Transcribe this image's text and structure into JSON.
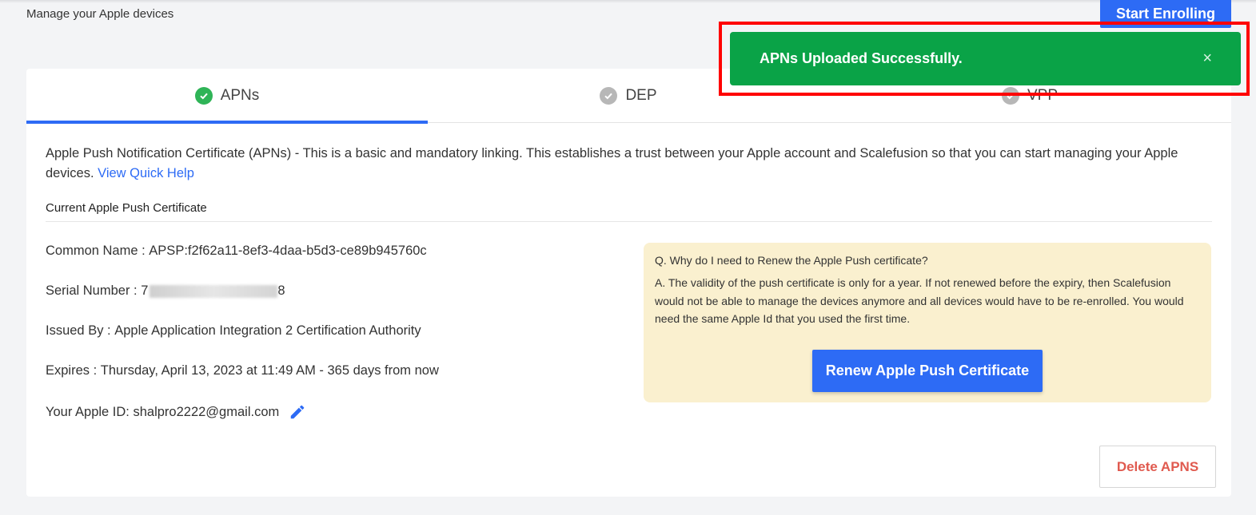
{
  "header": {
    "subtitle": "Manage your Apple devices",
    "start_enrolling_label": "Start Enrolling"
  },
  "tabs": [
    {
      "label": "APNs",
      "status": "complete",
      "active": true
    },
    {
      "label": "DEP",
      "status": "incomplete",
      "active": false
    },
    {
      "label": "VPP",
      "status": "incomplete",
      "active": false
    }
  ],
  "apns": {
    "description": "Apple Push Notification Certificate (APNs) - This is a basic and mandatory linking. This establishes a trust between your Apple account and Scalefusion so that you can start managing your Apple devices.",
    "help_link": "View Quick Help",
    "section_title": "Current Apple Push Certificate",
    "common_name_label": "Common Name :",
    "common_name_value": "APSP:f2f62a11-8ef3-4daa-b5d3-ce89b945760c",
    "serial_label": "Serial Number :",
    "serial_prefix": "7",
    "serial_suffix": "8",
    "issued_by_label": "Issued By :",
    "issued_by_value": "Apple Application Integration 2 Certification Authority",
    "expires_label": "Expires :",
    "expires_value": "Thursday, April 13, 2023 at 11:49 AM - 365 days from now",
    "apple_id_label": "Your Apple ID:",
    "apple_id_value": "shalpro2222@gmail.com",
    "delete_label": "Delete APNS"
  },
  "info": {
    "question": "Q. Why do I need to Renew the Apple Push certificate?",
    "answer": "A. The validity of the push certificate is only for a year. If not renewed before the expiry, then Scalefusion would not be able to manage the devices anymore and all devices would have to be re-enrolled. You would need the same Apple Id that you used the first time.",
    "renew_label": "Renew Apple Push Certificate"
  },
  "toast": {
    "message": "APNs Uploaded Successfully.",
    "close": "×"
  },
  "colors": {
    "accent": "#2d6bf5",
    "success": "#0aa347",
    "info_bg": "#faf0cf",
    "danger": "#e05a4f",
    "highlight": "#ff0000"
  },
  "icons": {
    "tab_check": "check-circle-icon",
    "edit": "pencil-icon",
    "close": "close-icon"
  }
}
